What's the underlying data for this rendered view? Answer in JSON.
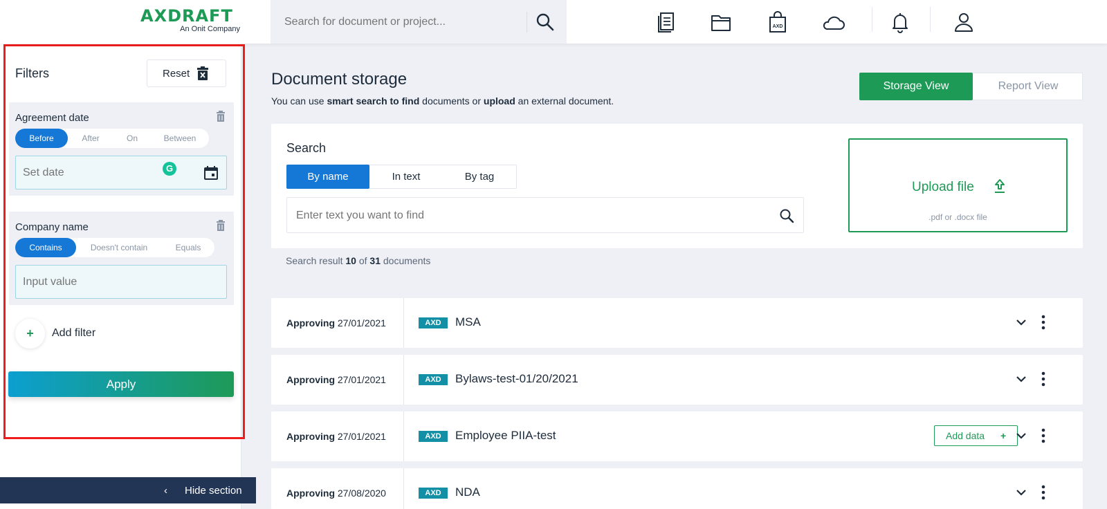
{
  "header": {
    "logo_main": "AXDRAFT",
    "logo_sub": "An Onit Company",
    "search_placeholder": "Search for document or project...",
    "icons": [
      "search-icon",
      "documents-icon",
      "folder-icon",
      "axd-bag-icon",
      "cloud-icon",
      "bell-icon",
      "user-icon"
    ]
  },
  "sidebar": {
    "title": "Filters",
    "reset_label": "Reset",
    "agreement_date": {
      "title": "Agreement date",
      "options": [
        "Before",
        "After",
        "On",
        "Between"
      ],
      "selected": "Before",
      "input_placeholder": "Set date",
      "grammarly_letter": "G"
    },
    "company_name": {
      "title": "Company name",
      "options": [
        "Contains",
        "Doesn't contain",
        "Equals"
      ],
      "selected": "Contains",
      "input_placeholder": "Input value"
    },
    "add_filter_symbol": "+",
    "add_filter_label": "Add filter",
    "apply_label": "Apply",
    "hide_section_chevron": "‹",
    "hide_section_label": "Hide section"
  },
  "main": {
    "title": "Document storage",
    "subtitle_parts": [
      "You can use ",
      "smart search to find",
      " documents or ",
      "upload",
      " an external document."
    ],
    "view_toggle": {
      "active": "Storage View",
      "inactive": "Report View"
    },
    "search": {
      "title": "Search",
      "tabs": [
        "By name",
        "In text",
        "By tag"
      ],
      "selected_tab": "By name",
      "input_placeholder": "Enter text you want to find"
    },
    "upload": {
      "label": "Upload file",
      "hint": ".pdf or .docx file"
    },
    "result": {
      "prefix": "Search result ",
      "shown": "10",
      "middle": " of ",
      "total": "31",
      "suffix": " documents"
    },
    "documents": [
      {
        "status": "Approving",
        "date": "27/01/2021",
        "badge": "AXD",
        "name": "MSA"
      },
      {
        "status": "Approving",
        "date": "27/01/2021",
        "badge": "AXD",
        "name": "Bylaws-test-01/20/2021"
      },
      {
        "status": "Approving",
        "date": "27/01/2021",
        "badge": "AXD",
        "name": "Employee PIIA-test",
        "action": "Add data",
        "action_symbol": "+"
      },
      {
        "status": "Approving",
        "date": "27/08/2020",
        "badge": "AXD",
        "name": "NDA"
      }
    ]
  },
  "colors": {
    "brand_green": "#1e9a57",
    "active_blue": "#1577d6",
    "badge_teal": "#138fa6",
    "dark_navy": "#233554",
    "highlight_red": "#ef1c1c"
  }
}
